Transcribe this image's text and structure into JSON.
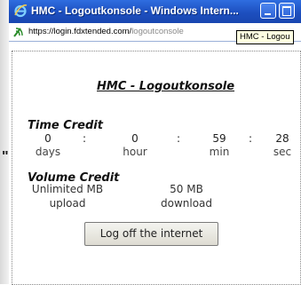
{
  "window": {
    "title": "HMC - Logoutkonsole - Windows Intern..."
  },
  "address": {
    "url_host": "https://login.fdxtended.com/",
    "url_path": "logoutconsole"
  },
  "tooltip": {
    "text": "HMC - Logou"
  },
  "page": {
    "heading": "HMC - Logoutkonsole",
    "time_credit": {
      "label": "Time Credit",
      "days": "0",
      "hours": "0",
      "minutes": "59",
      "seconds": "28",
      "days_unit": "days",
      "hours_unit": "hour",
      "minutes_unit": "min",
      "seconds_unit": "sec",
      "separator": ":"
    },
    "volume_credit": {
      "label": "Volume Credit",
      "upload_value": "Unlimited MB",
      "upload_label": "upload",
      "download_value": "50 MB",
      "download_label": "download"
    },
    "logoff_button": "Log off the internet"
  },
  "left_edge": {
    "quote": "\""
  }
}
